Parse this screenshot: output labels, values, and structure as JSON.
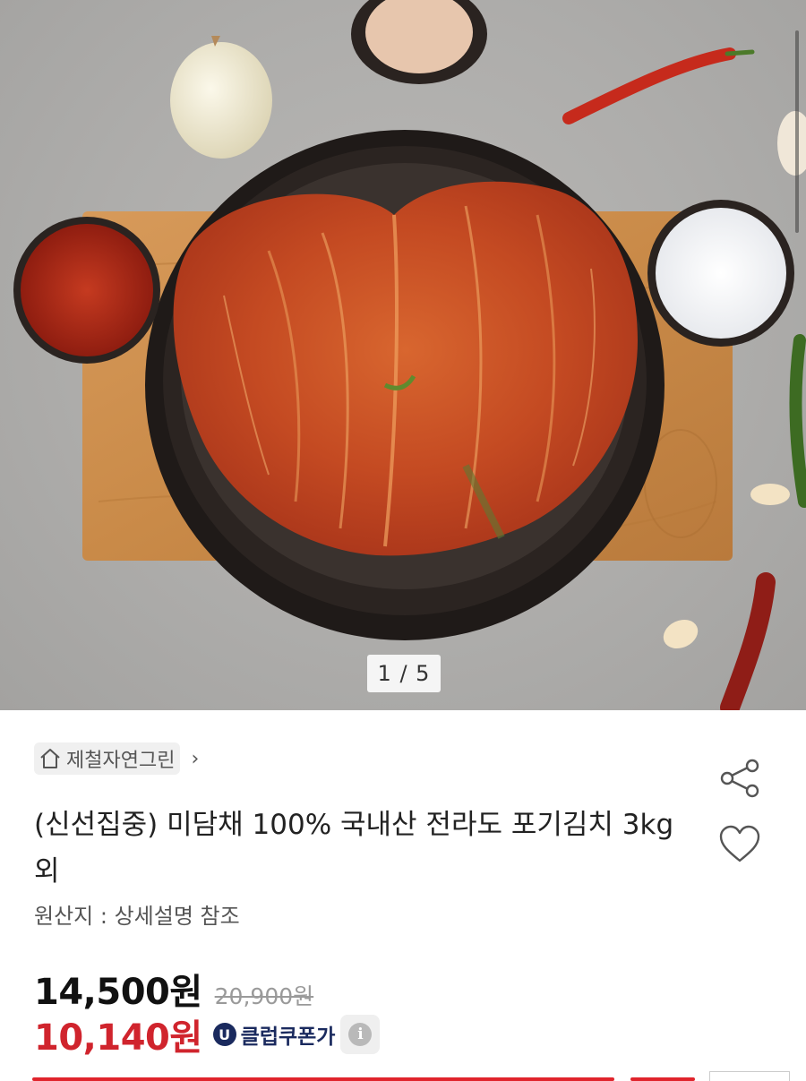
{
  "gallery": {
    "counter": "1 / 5",
    "image_subject": "kimchi-bowl-photo"
  },
  "seller": {
    "name": "제철자연그린",
    "icon": "home-icon"
  },
  "product": {
    "title": "(신선집중) 미담채 100% 국내산 전라도 포기김치 3kg 외",
    "origin": "원산지 : 상세설명 참조"
  },
  "pricing": {
    "price": "14,500원",
    "original_price": "20,900원",
    "coupon_price": "10,140원",
    "coupon_badge": "U",
    "coupon_label": "클럽쿠폰가",
    "info_symbol": "i"
  },
  "actions": {
    "share_icon": "share-icon",
    "like_icon": "heart-icon"
  },
  "colors": {
    "accent_red": "#d0242d",
    "coupon_navy": "#1a2a5e"
  }
}
